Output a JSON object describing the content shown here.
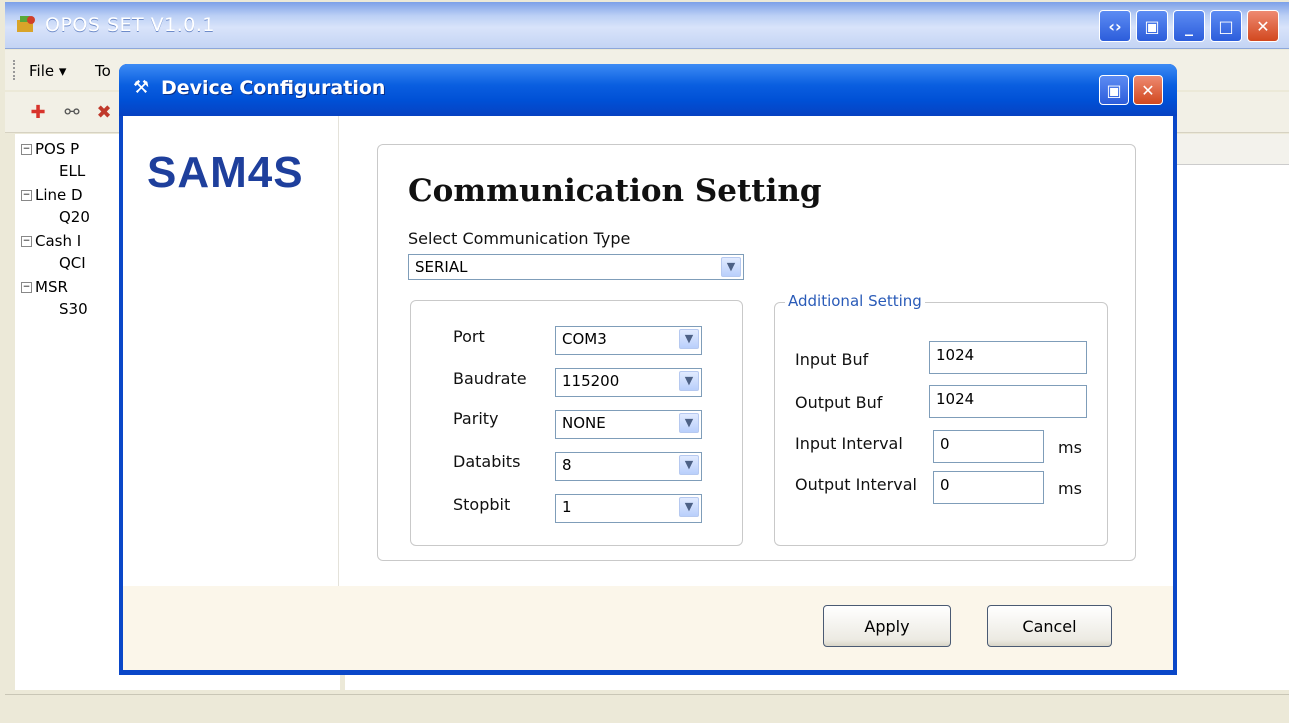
{
  "main_window": {
    "title": "OPOS SET V1.0.1",
    "menu": {
      "file": "File ▾",
      "tools": "To"
    },
    "tree": [
      {
        "label": "POS P",
        "child": "ELL"
      },
      {
        "label": "Line D",
        "child": "Q20"
      },
      {
        "label": "Cash I",
        "child": "QCI"
      },
      {
        "label": "MSR",
        "child": "S30"
      }
    ]
  },
  "dialog": {
    "title": "Device Configuration",
    "logo": "SAM4S",
    "heading": "Communication Setting",
    "comm_type_label": "Select Communication Type",
    "comm_type_value": "SERIAL",
    "serial": {
      "port_label": "Port",
      "port_value": "COM3",
      "baud_label": "Baudrate",
      "baud_value": "115200",
      "parity_label": "Parity",
      "parity_value": "NONE",
      "databits_label": "Databits",
      "databits_value": "8",
      "stopbit_label": "Stopbit",
      "stopbit_value": "1"
    },
    "additional": {
      "legend": "Additional Setting",
      "input_buf_label": "Input Buf",
      "input_buf_value": "1024",
      "output_buf_label": "Output Buf",
      "output_buf_value": "1024",
      "input_interval_label": "Input Interval",
      "input_interval_value": "0",
      "output_interval_label": "Output Interval",
      "output_interval_value": "0",
      "unit": "ms"
    },
    "apply_label": "Apply",
    "cancel_label": "Cancel"
  }
}
